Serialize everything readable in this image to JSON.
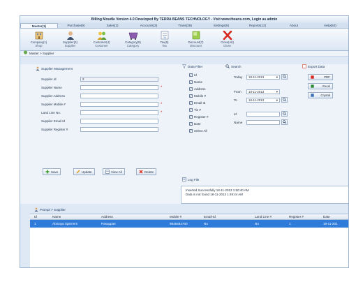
{
  "app": {
    "title": "Billing Moudle Version 4.0 Developed By TERRA BEANS TECHNOLOGY - Visit www.tbeans.com,    Login as admin"
  },
  "menu": {
    "tabs": [
      {
        "label": "Master(1)"
      },
      {
        "label": "Purchase(9)"
      },
      {
        "label": "Sales(2)"
      },
      {
        "label": "Accounts(3)"
      },
      {
        "label": "Trans(28)"
      },
      {
        "label": "Settings(5)"
      },
      {
        "label": "Reports(12)"
      },
      {
        "label": "About"
      },
      {
        "label": "Help(50)"
      }
    ]
  },
  "ribbon": {
    "buttons": [
      {
        "label": "Company(1)",
        "sub": "Shop",
        "icon": "company-icon"
      },
      {
        "label": "Supplier(3)",
        "sub": "Supplier",
        "icon": "supplier-icon"
      },
      {
        "label": "Customer(4)",
        "sub": "Customer",
        "icon": "customer-icon"
      },
      {
        "label": "Category(5)",
        "sub": "Category",
        "icon": "category-icon"
      },
      {
        "label": "Tax(6)",
        "sub": "Tax",
        "icon": "tax-icon"
      },
      {
        "label": "Discount(7)",
        "sub": "Discount",
        "icon": "discount-icon"
      },
      {
        "label": "Close(Alt)",
        "sub": "Close",
        "icon": "close-icon"
      }
    ]
  },
  "breadcrumb": "Master > Supplier",
  "supplier": {
    "title": "Supplier Management",
    "fields": [
      {
        "label": "Supplier Id",
        "value": "2",
        "required": false
      },
      {
        "label": "Supplier Name",
        "value": "",
        "required": true
      },
      {
        "label": "Supplier Address",
        "value": "",
        "required": false
      },
      {
        "label": "Supplier Mobile #",
        "value": "",
        "required": true
      },
      {
        "label": "Land Line No.",
        "value": "",
        "required": true
      },
      {
        "label": "Supplier Email Id",
        "value": "",
        "required": false
      },
      {
        "label": "Supplier Register #",
        "value": "",
        "required": false
      }
    ],
    "buttons": {
      "save": "Save",
      "update": "Update",
      "view_all": "View All",
      "delete": "Delete"
    }
  },
  "filter": {
    "title": "Data Filter",
    "items": [
      "Id",
      "Name",
      "Address",
      "Mobile #",
      "Email Id",
      "Tin #",
      "Register #",
      "Date",
      "Select All"
    ]
  },
  "search": {
    "title": "Search",
    "today_label": "Today",
    "today_value": "18-11-2013",
    "from_label": "From",
    "from_value": "18-11-2013",
    "to_label": "To",
    "to_value": "18-11-2013",
    "id_label": "Id",
    "name_label": "Name"
  },
  "export": {
    "title": "Export Data",
    "pdf": "PDF",
    "excel": "Excel",
    "crystal": "Crystal"
  },
  "log": {
    "title": "Log File",
    "line1": "Inserted Successfully  18-11-2013 1:50:40 AM",
    "line2": "Data is not found  18-11-2013 1:49:44 AM"
  },
  "prompt": "Prompt > Supplier",
  "grid": {
    "columns": [
      "Id",
      "Name",
      "Address",
      "Mobile #",
      "Email-Id",
      "Land Line #",
      "Register #",
      "Date"
    ],
    "rows": [
      [
        "1",
        "Abinaya Spinners",
        "Pasuppae",
        "9848482700",
        "No",
        "No",
        "1",
        "18-11-201"
      ]
    ]
  },
  "colors": {
    "accent": "#2f7bd9",
    "required": "#d12a2a",
    "window_bg": "#dfe9f5"
  }
}
